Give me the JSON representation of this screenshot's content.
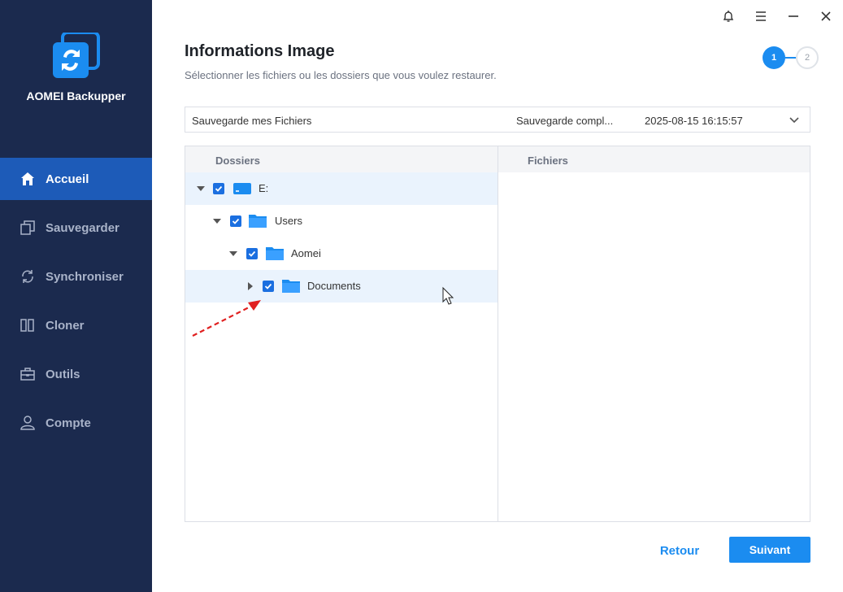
{
  "app": {
    "name": "AOMEI Backupper"
  },
  "sidebar": {
    "items": [
      {
        "label": "Accueil",
        "icon": "home-icon",
        "active": true
      },
      {
        "label": "Sauvegarder",
        "icon": "backup-icon"
      },
      {
        "label": "Synchroniser",
        "icon": "sync-icon"
      },
      {
        "label": "Cloner",
        "icon": "clone-icon"
      },
      {
        "label": "Outils",
        "icon": "toolbox-icon"
      },
      {
        "label": "Compte",
        "icon": "user-icon"
      }
    ]
  },
  "window_controls": [
    "bell-icon",
    "menu-icon",
    "minimize-icon",
    "close-icon"
  ],
  "header": {
    "title": "Informations Image",
    "subtitle": "Sélectionner les fichiers ou les dossiers que vous voulez restaurer."
  },
  "steps": {
    "current": "1",
    "next": "2"
  },
  "backup": {
    "name": "Sauvegarde mes Fichiers",
    "type": "Sauvegarde compl...",
    "date": "2025-08-15 16:15:57"
  },
  "panels": {
    "folders_header": "Dossiers",
    "files_header": "Fichiers"
  },
  "tree": [
    {
      "label": "E:",
      "expanded": true,
      "checked": true,
      "icon": "drive-icon"
    },
    {
      "label": "Users",
      "expanded": true,
      "checked": true,
      "icon": "folder-icon"
    },
    {
      "label": "Aomei",
      "expanded": true,
      "checked": true,
      "icon": "folder-icon"
    },
    {
      "label": "Documents",
      "expanded": false,
      "checked": true,
      "icon": "folder-icon"
    }
  ],
  "footer": {
    "back_label": "Retour",
    "next_label": "Suivant"
  },
  "colors": {
    "sidebar_bg": "#1b2a4e",
    "active_item": "#1d5bb8",
    "accent": "#1b8cf0",
    "annotation": "#e02020"
  }
}
